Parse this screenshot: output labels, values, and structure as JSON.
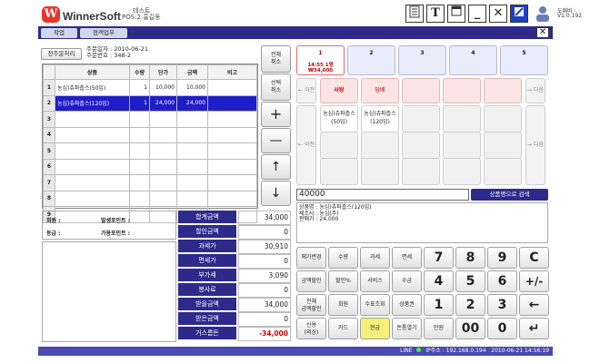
{
  "app": {
    "logo_letter": "W",
    "name": "WinnerSoft",
    "store": "테스트",
    "pos": "POS:2 홍길동",
    "user": "도패비",
    "version": "V1.0.192"
  },
  "toolbar": {
    "t": "T",
    "min": "_",
    "x": "✕"
  },
  "menu": {
    "tab1": "작업",
    "tab2": "점객업무",
    "close": "✕"
  },
  "receipt": {
    "hold": "전주문처리",
    "date": "주문일자 : 2010-06-21",
    "no": "주문번호 : 348-2"
  },
  "table": {
    "headers": [
      "상품",
      "수량",
      "단가",
      "금액",
      "비고"
    ],
    "rows": [
      {
        "n": "1",
        "name": "농심)츄파춥스(50입)",
        "qty": "1",
        "price": "10,000",
        "amt": "10,000"
      },
      {
        "n": "2",
        "name": "농심)츄파춥스(120입)",
        "qty": "1",
        "price": "24,000",
        "amt": "24,000"
      },
      {
        "n": "3"
      },
      {
        "n": "4"
      },
      {
        "n": "5"
      },
      {
        "n": "6"
      },
      {
        "n": "7"
      },
      {
        "n": "8"
      },
      {
        "n": "9"
      }
    ]
  },
  "side": {
    "cancel_all": "전체\n취소",
    "cancel_sel": "선택\n취소",
    "plus": "+",
    "minus": "—",
    "up": "↑",
    "down": "↓"
  },
  "member": {
    "label": "회원 :",
    "points_issued": "발생포인트 :",
    "grade": "등급 :",
    "points_avail": "가용포인트 :"
  },
  "totals": [
    {
      "label": "합계금액",
      "value": "34,000"
    },
    {
      "label": "할인금액",
      "value": "0"
    },
    {
      "label": "과세가",
      "value": "30,910"
    },
    {
      "label": "면세가",
      "value": "0"
    },
    {
      "label": "부가세",
      "value": "3,090"
    },
    {
      "label": "봉사료",
      "value": "0"
    },
    {
      "label": "받을금액",
      "value": "34,000"
    },
    {
      "label": "받은금액",
      "value": "0"
    },
    {
      "label": "거스름돈",
      "value": "-34,000"
    }
  ],
  "tables": [
    {
      "num": "1",
      "time": "14:55 1명",
      "amount": "₩34,000"
    },
    {
      "num": "2"
    },
    {
      "num": "3"
    },
    {
      "num": "4"
    },
    {
      "num": "5"
    }
  ],
  "categories": [
    "사탕",
    "담배"
  ],
  "products": [
    "농심)츄파춥스(50입)",
    "농심)츄파춥스(120입)"
  ],
  "nav": {
    "prev": "이전",
    "next": "다음"
  },
  "input": {
    "amount": "40000",
    "search": "상품명으로 검색"
  },
  "detail": {
    "line1": "상품명 : 농심)츄파춥스(120입)",
    "line2": "제조사 : 농심(주)",
    "line3": "판매가 : 24,000"
  },
  "keys": {
    "r1": [
      "메가변경",
      "수량",
      "과세",
      "면세"
    ],
    "r2": [
      "금액할인",
      "할인%",
      "서비스",
      "수금"
    ],
    "r3": [
      "전체\n금액할인",
      "회원",
      "수표조회",
      "상품권"
    ],
    "r4": [
      "신용\n(외상)",
      "카드",
      "현금",
      "돈통열기",
      "만원"
    ],
    "n1": [
      "7",
      "8",
      "9",
      "C"
    ],
    "n2": [
      "4",
      "5",
      "6",
      "+/-"
    ],
    "n3": [
      "1",
      "2",
      "3",
      "←"
    ],
    "n4": [
      "00",
      "0",
      "↵"
    ]
  },
  "status": {
    "line": "LINE",
    "ip": "IP주소 : 192.168.0.194",
    "datetime": "2010-06-21 14:56:19"
  }
}
